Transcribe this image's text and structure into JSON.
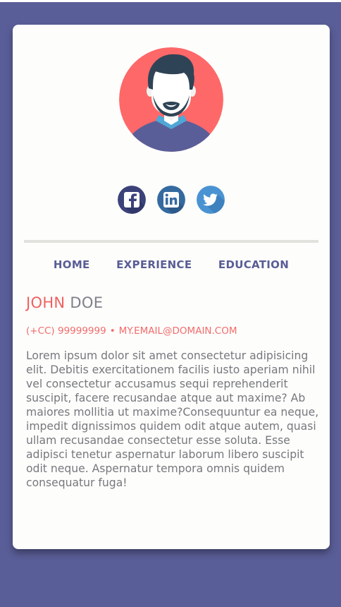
{
  "profile": {
    "first_name": "JOHN",
    "last_name": "DOE",
    "phone": "(+CC) 99999999",
    "separator": "•",
    "email": "MY.EMAIL@DOMAIN.COM",
    "bio": "Lorem ipsum dolor sit amet consectetur adipisicing elit. Debitis exercitationem facilis iusto aperiam nihil vel consectetur accusamus sequi reprehenderit suscipit, facere recusandae atque aut maxime? Ab maiores mollitia ut maxime?Consequuntur ea neque, impedit dignissimos quidem odit atque autem, quasi ullam recusandae consectetur esse soluta. Esse adipisci tenetur aspernatur laborum libero suscipit odit neque. Aspernatur tempora omnis quidem consequatur fuga!"
  },
  "social": [
    {
      "name": "facebook",
      "icon": "facebook-icon",
      "color": "#3b4279"
    },
    {
      "name": "linkedin",
      "icon": "linkedin-icon",
      "color": "#356aa0"
    },
    {
      "name": "twitter",
      "icon": "twitter-icon",
      "color": "#4a93d3"
    }
  ],
  "nav": {
    "home": "HOME",
    "experience": "EXPERIENCE",
    "education": "EDUCATION"
  },
  "colors": {
    "background": "#5a5e98",
    "card": "#fdfdfb",
    "accent_red": "#f06060",
    "nav_text": "#595d96",
    "body_text": "#76787e"
  }
}
